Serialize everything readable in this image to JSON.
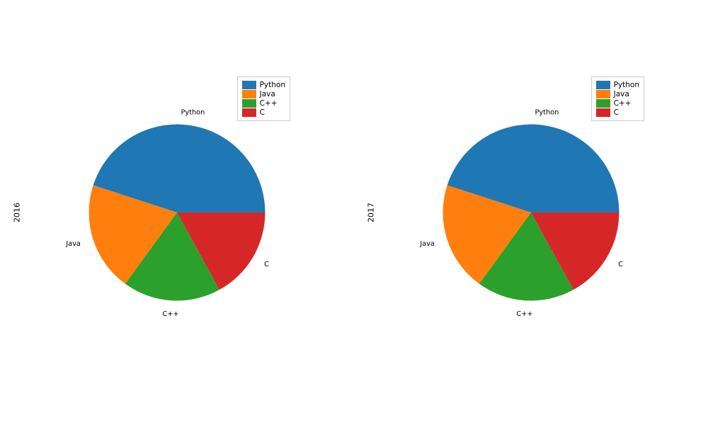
{
  "chart_data": [
    {
      "type": "pie",
      "ylabel": "2016",
      "labels": [
        "Python",
        "Java",
        "C++",
        "C"
      ],
      "values": [
        45,
        20,
        18,
        17
      ],
      "colors": [
        "#1f77b4",
        "#ff7f0e",
        "#2ca02c",
        "#d62728"
      ],
      "legend_position": "top-right"
    },
    {
      "type": "pie",
      "ylabel": "2017",
      "labels": [
        "Python",
        "Java",
        "C++",
        "C"
      ],
      "values": [
        45,
        20,
        18,
        17
      ],
      "colors": [
        "#1f77b4",
        "#ff7f0e",
        "#2ca02c",
        "#d62728"
      ],
      "legend_position": "top-right"
    }
  ]
}
